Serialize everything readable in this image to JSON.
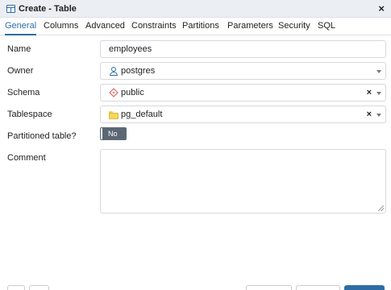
{
  "dialog": {
    "title": "Create - Table",
    "close_glyph": "×",
    "title_icon": "table-icon"
  },
  "tabs": [
    {
      "label": "General",
      "active": true
    },
    {
      "label": "Columns"
    },
    {
      "label": "Advanced"
    },
    {
      "label": "Constraints"
    },
    {
      "label": "Partitions"
    },
    {
      "label": "Parameters"
    },
    {
      "label": "Security"
    },
    {
      "label": "SQL"
    }
  ],
  "form": {
    "name": {
      "label": "Name",
      "value": "employees"
    },
    "owner": {
      "label": "Owner",
      "value": "postgres",
      "icon": "user-icon"
    },
    "schema": {
      "label": "Schema",
      "value": "public",
      "icon": "schema-icon",
      "clear_glyph": "×"
    },
    "tablespace": {
      "label": "Tablespace",
      "value": "pg_default",
      "icon": "folder-icon",
      "clear_glyph": "×"
    },
    "partitioned": {
      "label": "Partitioned table?",
      "value": "No"
    },
    "comment": {
      "label": "Comment",
      "value": ""
    }
  },
  "colors": {
    "accent": "#2e6da4",
    "toggle_bg": "#5b6874",
    "schema_icon": "#d9534f",
    "folder_icon": "#f3d95a"
  }
}
